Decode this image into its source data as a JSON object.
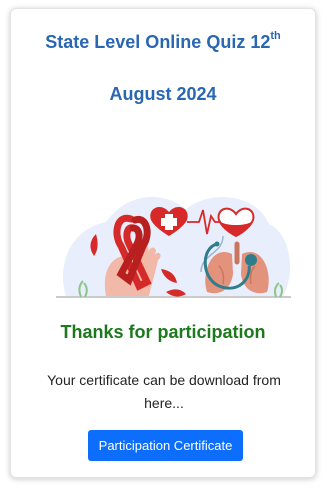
{
  "card": {
    "title_line1_main": "State Level Online Quiz 12",
    "title_line1_sup": "th",
    "title_line2": "August 2024",
    "thanks": "Thanks for participation",
    "message": "Your certificate can be download from here...",
    "button_label": "Participation Certificate"
  },
  "colors": {
    "title": "#2a67b2",
    "thanks": "#1c7a1c",
    "button": "#0d6efd",
    "accent_red": "#d62a2a",
    "lungs": "#e3927b",
    "stethoscope": "#2f7d8c"
  },
  "icons": {
    "illustration": "health-illustration",
    "parts": [
      "ribbon-icon",
      "heart-medical-cross-icon",
      "blood-drop-heart-icon",
      "lungs-icon",
      "stethoscope-icon"
    ]
  }
}
